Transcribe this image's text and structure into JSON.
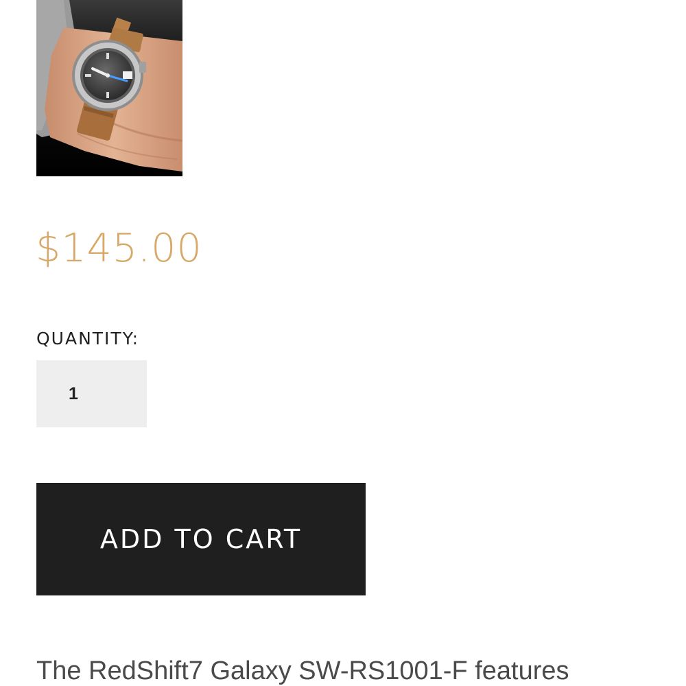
{
  "product": {
    "price": "$145.00",
    "quantity_label": "QUANTITY:",
    "quantity_value": "1",
    "add_to_cart_label": "ADD TO CART",
    "description_start": "The RedShift7 Galaxy SW-RS1001-F features"
  },
  "colors": {
    "price": "#d8a868",
    "button_bg": "#1f1f1f",
    "quantity_bg": "#eeeeee"
  }
}
